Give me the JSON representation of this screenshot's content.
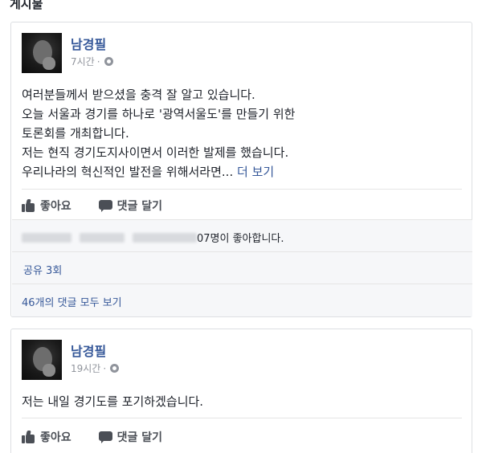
{
  "section": {
    "title": "게시물"
  },
  "posts": [
    {
      "author": "남경필",
      "time": "7시간",
      "separator": "·",
      "privacy_icon": "globe-icon",
      "lines": [
        "여러분들께서 받으셨을 충격 잘 알고 있습니다.",
        "오늘 서울과 경기를 하나로 '광역서울도'를 만들기 위한",
        "토론회를 개최합니다.",
        "저는 현직 경기도지사이면서 이러한 발제를 했습니다.",
        "우리나라의 혁신적인 발전을 위해서라면..."
      ],
      "see_more": "더 보기",
      "like_label": "좋아요",
      "comment_label": "댓글 달기",
      "likes_text": "07명이 좋아합니다.",
      "shares_text": "공유 3회",
      "comments_text": "46개의 댓글 모두 보기"
    },
    {
      "author": "남경필",
      "time": "19시간",
      "separator": "·",
      "privacy_icon": "globe-icon",
      "lines": [
        "저는 내일 경기도를 포기하겠습니다."
      ],
      "like_label": "좋아요",
      "comment_label": "댓글 달기"
    }
  ],
  "colors": {
    "link": "#365899",
    "text": "#1d2129",
    "meta": "#90949c",
    "action": "#4b4f56",
    "feedback_bg": "#f6f7f9",
    "border": "#dddfe2"
  }
}
